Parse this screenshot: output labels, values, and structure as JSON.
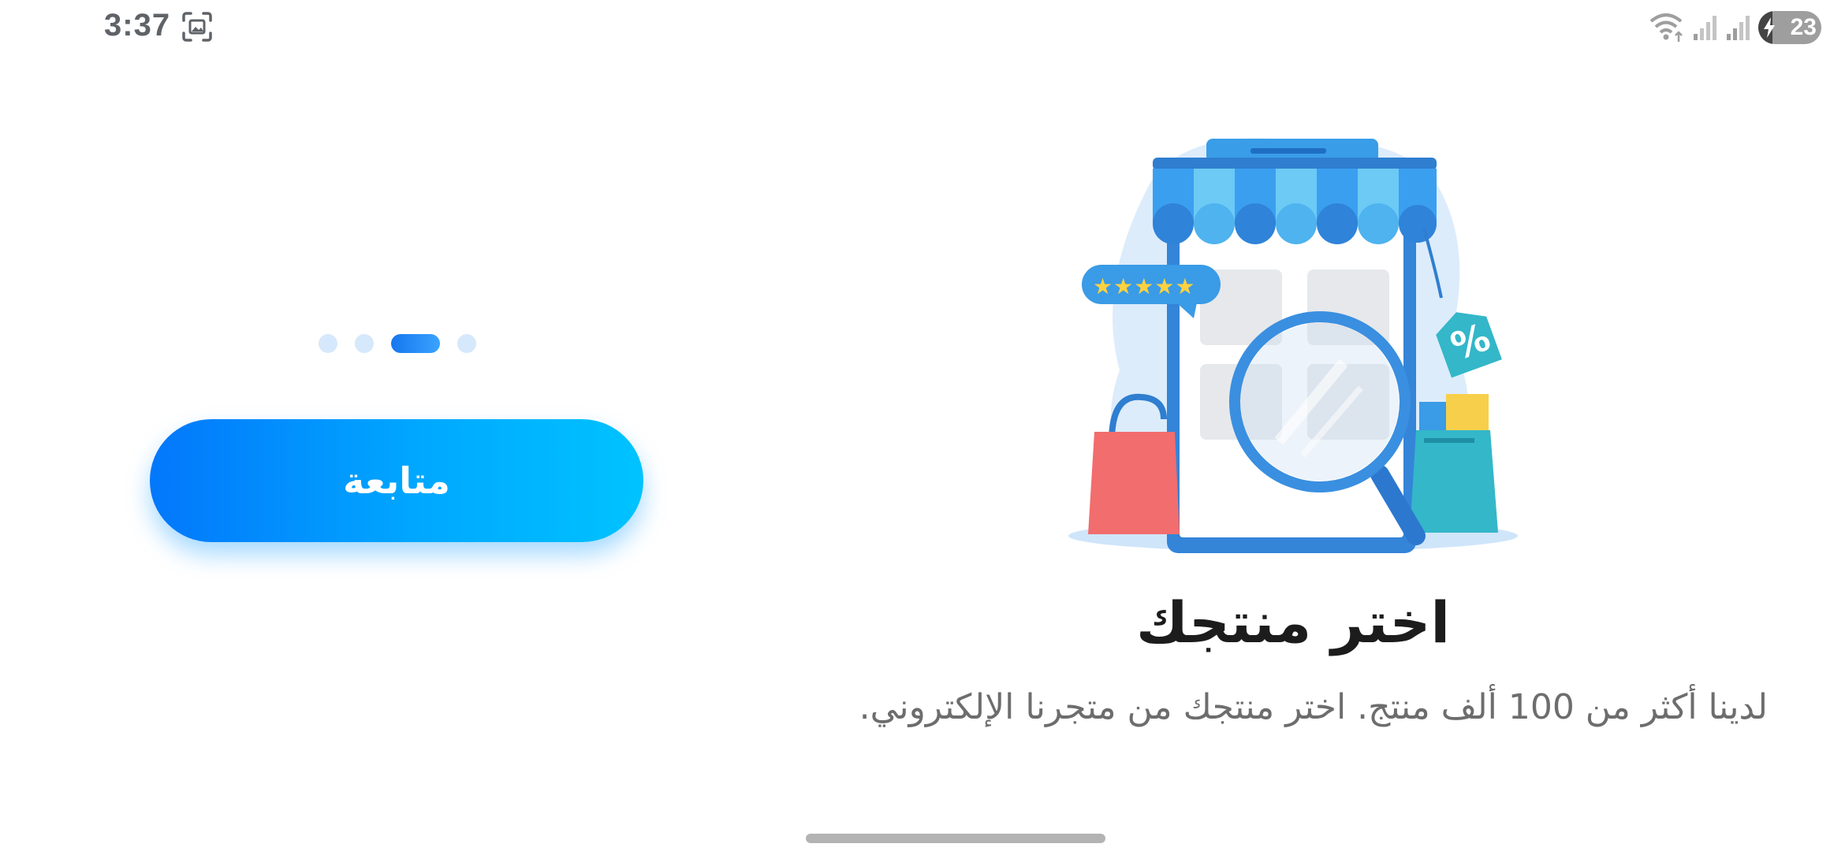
{
  "status_bar": {
    "time": "3:37",
    "battery_level": "23",
    "icons": [
      "screenshot-icon",
      "wifi-icon",
      "signal-icon",
      "signal-icon",
      "battery-charging-icon"
    ]
  },
  "onboarding": {
    "pages": 4,
    "active_page": 3,
    "continue_label": "متابعة",
    "title": "اختر منتجك",
    "description": "لدينا أكثر من 100 ألف منتج. اختر منتجك من متجرنا الإلكتروني."
  },
  "colors": {
    "accent_start": "#0377fb",
    "accent_end": "#00c3ff",
    "title": "#1c1c1c",
    "description": "#6d6d6d"
  }
}
